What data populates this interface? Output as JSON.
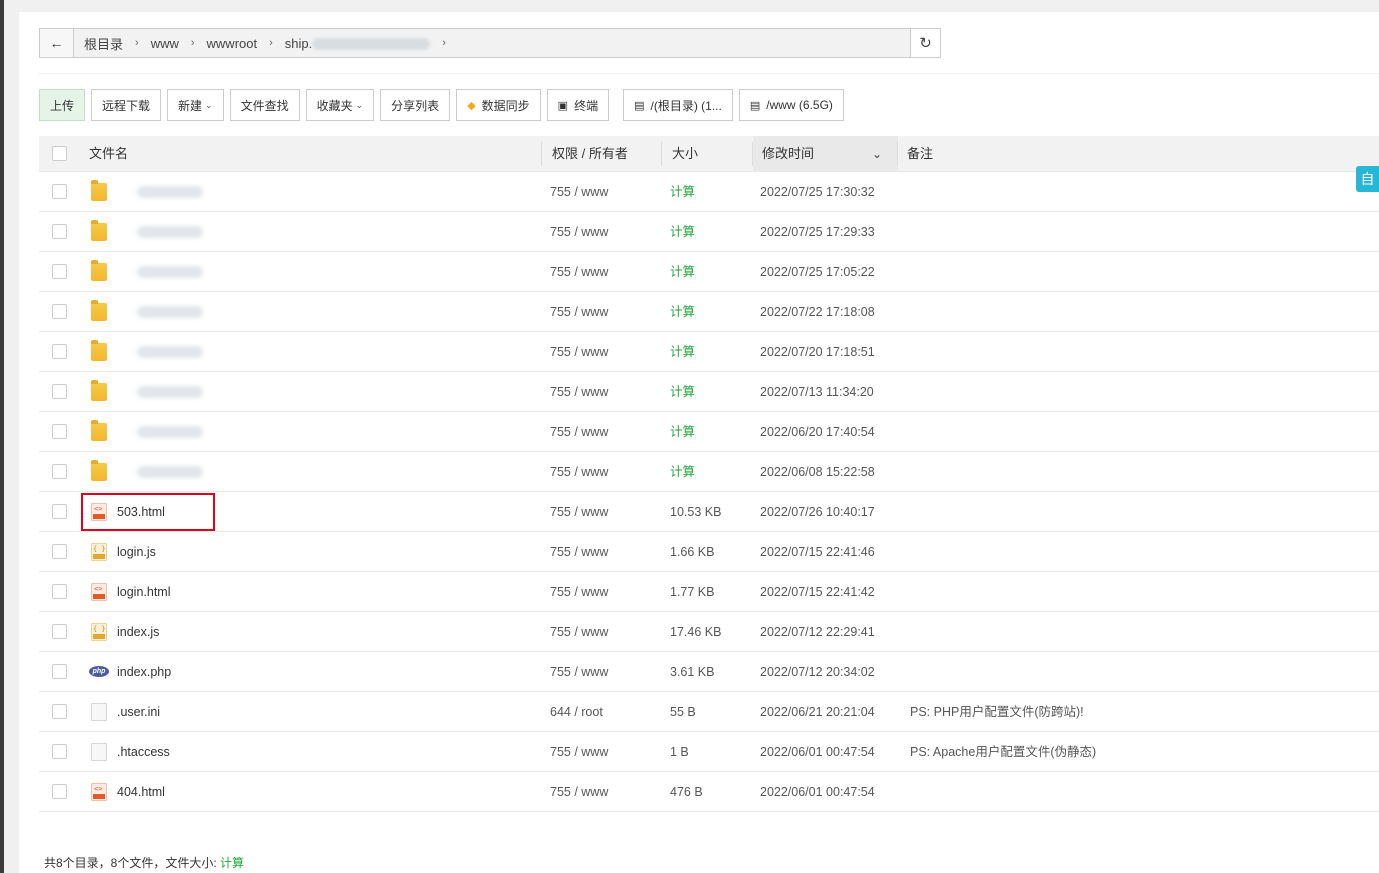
{
  "breadcrumb": {
    "items": [
      "根目录",
      "www",
      "wwwroot",
      "ship."
    ],
    "back_icon": "back-arrow-icon",
    "refresh_icon": "refresh-icon"
  },
  "toolbar": {
    "upload": "上传",
    "remote_download": "远程下载",
    "new": "新建",
    "file_search": "文件查找",
    "favorites": "收藏夹",
    "share_list": "分享列表",
    "data_sync": "数据同步",
    "terminal": "终端",
    "disk_root": "/(根目录) (1...",
    "disk_www": "/www (6.5G)"
  },
  "table": {
    "headers": {
      "name": "文件名",
      "perm": "权限 / 所有者",
      "size": "大小",
      "mtime": "修改时间",
      "note": "备注"
    },
    "rows": [
      {
        "type": "folder",
        "name": "",
        "perm": "755 / www",
        "size": "计算",
        "mtime": "2022/07/25 17:30:32",
        "note": ""
      },
      {
        "type": "folder",
        "name": "",
        "perm": "755 / www",
        "size": "计算",
        "mtime": "2022/07/25 17:29:33",
        "note": ""
      },
      {
        "type": "folder",
        "name": "",
        "perm": "755 / www",
        "size": "计算",
        "mtime": "2022/07/25 17:05:22",
        "note": ""
      },
      {
        "type": "folder",
        "name": "",
        "perm": "755 / www",
        "size": "计算",
        "mtime": "2022/07/22 17:18:08",
        "note": ""
      },
      {
        "type": "folder",
        "name": "",
        "perm": "755 / www",
        "size": "计算",
        "mtime": "2022/07/20 17:18:51",
        "note": ""
      },
      {
        "type": "folder",
        "name": "",
        "perm": "755 / www",
        "size": "计算",
        "mtime": "2022/07/13 11:34:20",
        "note": ""
      },
      {
        "type": "folder",
        "name": "",
        "perm": "755 / www",
        "size": "计算",
        "mtime": "2022/06/20 17:40:54",
        "note": ""
      },
      {
        "type": "folder",
        "name": "",
        "perm": "755 / www",
        "size": "计算",
        "mtime": "2022/06/08 15:22:58",
        "note": ""
      },
      {
        "type": "html",
        "name": "503.html",
        "perm": "755 / www",
        "size": "10.53 KB",
        "mtime": "2022/07/26 10:40:17",
        "note": ""
      },
      {
        "type": "js",
        "name": "login.js",
        "perm": "755 / www",
        "size": "1.66 KB",
        "mtime": "2022/07/15 22:41:46",
        "note": ""
      },
      {
        "type": "html",
        "name": "login.html",
        "perm": "755 / www",
        "size": "1.77 KB",
        "mtime": "2022/07/15 22:41:42",
        "note": ""
      },
      {
        "type": "js",
        "name": "index.js",
        "perm": "755 / www",
        "size": "17.46 KB",
        "mtime": "2022/07/12 22:29:41",
        "note": ""
      },
      {
        "type": "php",
        "name": "index.php",
        "perm": "755 / www",
        "size": "3.61 KB",
        "mtime": "2022/07/12 20:34:02",
        "note": ""
      },
      {
        "type": "file",
        "name": ".user.ini",
        "perm": "644 / root",
        "size": "55 B",
        "mtime": "2022/06/21 20:21:04",
        "note": "PS: PHP用户配置文件(防跨站)!"
      },
      {
        "type": "file",
        "name": ".htaccess",
        "perm": "755 / www",
        "size": "1 B",
        "mtime": "2022/06/01 00:47:54",
        "note": "PS: Apache用户配置文件(伪静态)"
      },
      {
        "type": "html",
        "name": "404.html",
        "perm": "755 / www",
        "size": "476 B",
        "mtime": "2022/06/01 00:47:54",
        "note": ""
      }
    ]
  },
  "footer": {
    "summary": "共8个目录，8个文件，文件大小:",
    "calc": "计算"
  },
  "side_tab": "自",
  "php_badge": "php",
  "colors": {
    "accent_green": "#20a53a",
    "highlight_red": "#e0001a",
    "side_tab": "#25b7d3"
  }
}
